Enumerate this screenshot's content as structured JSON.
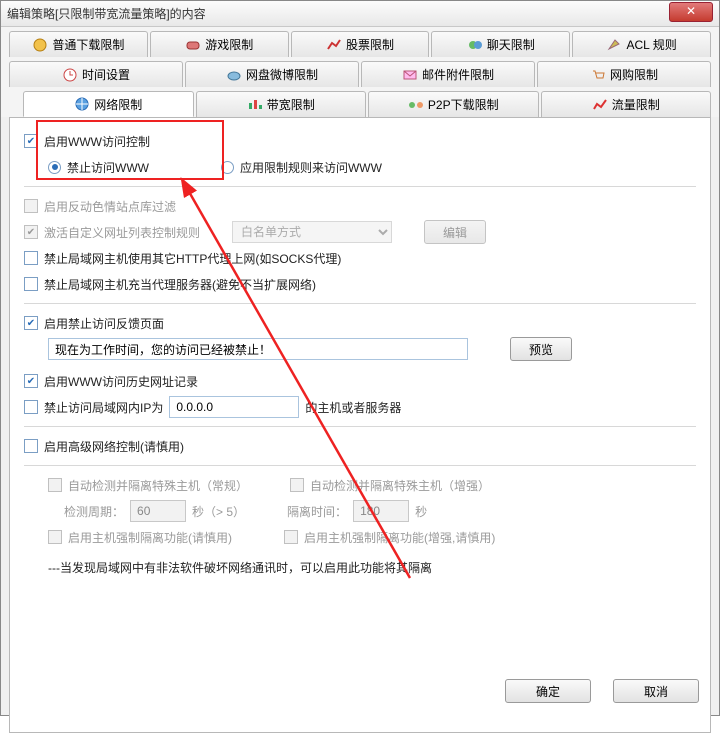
{
  "window": {
    "title": "编辑策略[只限制带宽流量策略]的内容"
  },
  "tabs_row1": [
    {
      "label": "普通下载限制",
      "name": "tab-download"
    },
    {
      "label": "游戏限制",
      "name": "tab-game"
    },
    {
      "label": "股票限制",
      "name": "tab-stock"
    },
    {
      "label": "聊天限制",
      "name": "tab-chat"
    },
    {
      "label": "ACL 规则",
      "name": "tab-acl"
    }
  ],
  "tabs_row2": [
    {
      "label": "时间设置",
      "name": "tab-time"
    },
    {
      "label": "网盘微博限制",
      "name": "tab-netdisk"
    },
    {
      "label": "邮件附件限制",
      "name": "tab-mail"
    },
    {
      "label": "网购限制",
      "name": "tab-shop"
    }
  ],
  "tabs_row3": [
    {
      "label": "网络限制",
      "name": "tab-network",
      "active": true
    },
    {
      "label": "带宽限制",
      "name": "tab-bandwidth"
    },
    {
      "label": "P2P下载限制",
      "name": "tab-p2p"
    },
    {
      "label": "流量限制",
      "name": "tab-traffic"
    }
  ],
  "net": {
    "enable_www_ctrl": "启用WWW访问控制",
    "forbid_www": "禁止访问WWW",
    "apply_rule_www": "应用限制规则来访问WWW",
    "enable_antiporn": "启用反动色情站点库过滤",
    "activate_url_rules": "激活自定义网址列表控制规则",
    "whitelist_mode": "白名单方式",
    "btn_edit": "编辑",
    "forbid_proxy": "禁止局域网主机使用其它HTTP代理上网(如SOCKS代理)",
    "forbid_host_proxy": "禁止局域网主机充当代理服务器(避免不当扩展网络)",
    "enable_feedback": "启用禁止访问反馈页面",
    "feedback_text": "现在为工作时间，您的访问已经被禁止！",
    "btn_preview": "预览",
    "enable_history": "启用WWW访问历史网址记录",
    "forbid_lan_ip": "禁止访问局域网内IP为",
    "ip_value": "0.0.0.0",
    "ip_suffix": "的主机或者服务器",
    "enable_adv": "启用高级网络控制(请慎用)",
    "auto_detect_normal": "自动检测并隔离特殊主机（常规）",
    "auto_detect_enhanced": "自动检测并隔离特殊主机（增强）",
    "detect_period_lbl": "检测周期：",
    "detect_period_val": "60",
    "seconds_gt": "秒（> 5）",
    "isolate_time_lbl": "隔离时间：",
    "isolate_time_val": "180",
    "seconds": "秒",
    "enable_force_iso": "启用主机强制隔离功能(请慎用)",
    "enable_force_iso_enh": "启用主机强制隔离功能(增强,请慎用)",
    "note": "---当发现局域网中有非法软件破坏网络通讯时，可以启用此功能将其隔离"
  },
  "footer": {
    "ok": "确定",
    "cancel": "取消"
  }
}
